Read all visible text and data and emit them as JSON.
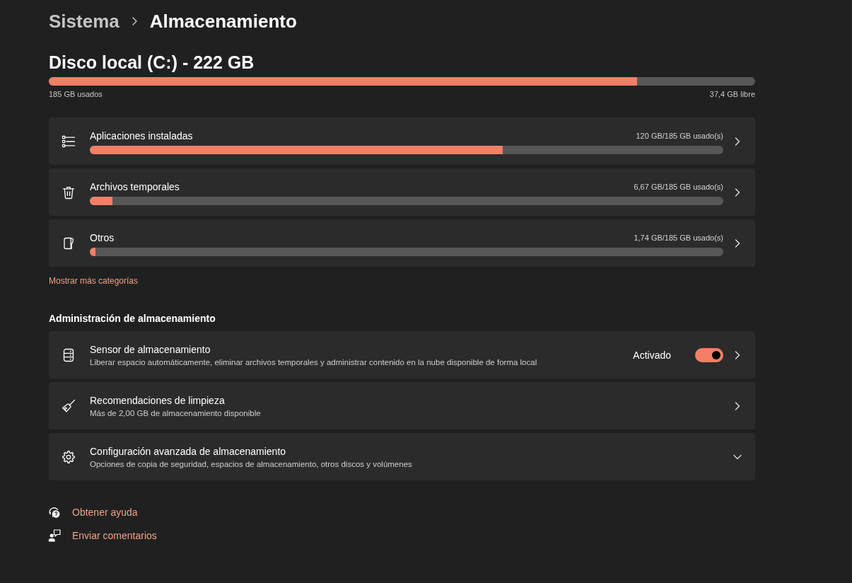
{
  "breadcrumb": [
    {
      "label": "Sistema",
      "current": false
    },
    {
      "label": "Almacenamiento",
      "current": true
    }
  ],
  "drive": {
    "title": "Disco local (C:) - 222 GB",
    "level": 0.833,
    "used": "185 GB usados",
    "free": "37,4 GB libre"
  },
  "categories": [
    {
      "label": "Aplicaciones instaladas",
      "usage": "120 GB/185 GB usado(s)",
      "level": 0.652
    },
    {
      "label": "Archivos temporales",
      "usage": "6,67 GB/185 GB usado(s)",
      "level": 0.036
    },
    {
      "label": "Otros",
      "usage": "1,74 GB/185 GB usado(s)",
      "level": 0.009
    }
  ],
  "show_more_link": "Mostrar más categorías",
  "management": {
    "heading": "Administración de almacenamiento",
    "items": [
      {
        "kind": "toggle",
        "title": "Sensor de almacenamiento",
        "description": "Liberar espacio automáticamente, eliminar archivos temporales y administrar contenido en la nube disponible de forma local",
        "toggle_label": "Activado",
        "on": true
      },
      {
        "kind": "link",
        "title": "Recomendaciones de limpieza",
        "description": "Más de 2,00 GB de almacenamiento disponible"
      },
      {
        "kind": "expander",
        "title": "Configuración avanzada de almacenamiento",
        "description": "Opciones de copia de seguridad, espacios de almacenamiento, otros discos y volúmenes",
        "expanded": false
      }
    ]
  },
  "footer_links": [
    {
      "label": "Obtener ayuda"
    },
    {
      "label": "Enviar comentarios"
    }
  ]
}
